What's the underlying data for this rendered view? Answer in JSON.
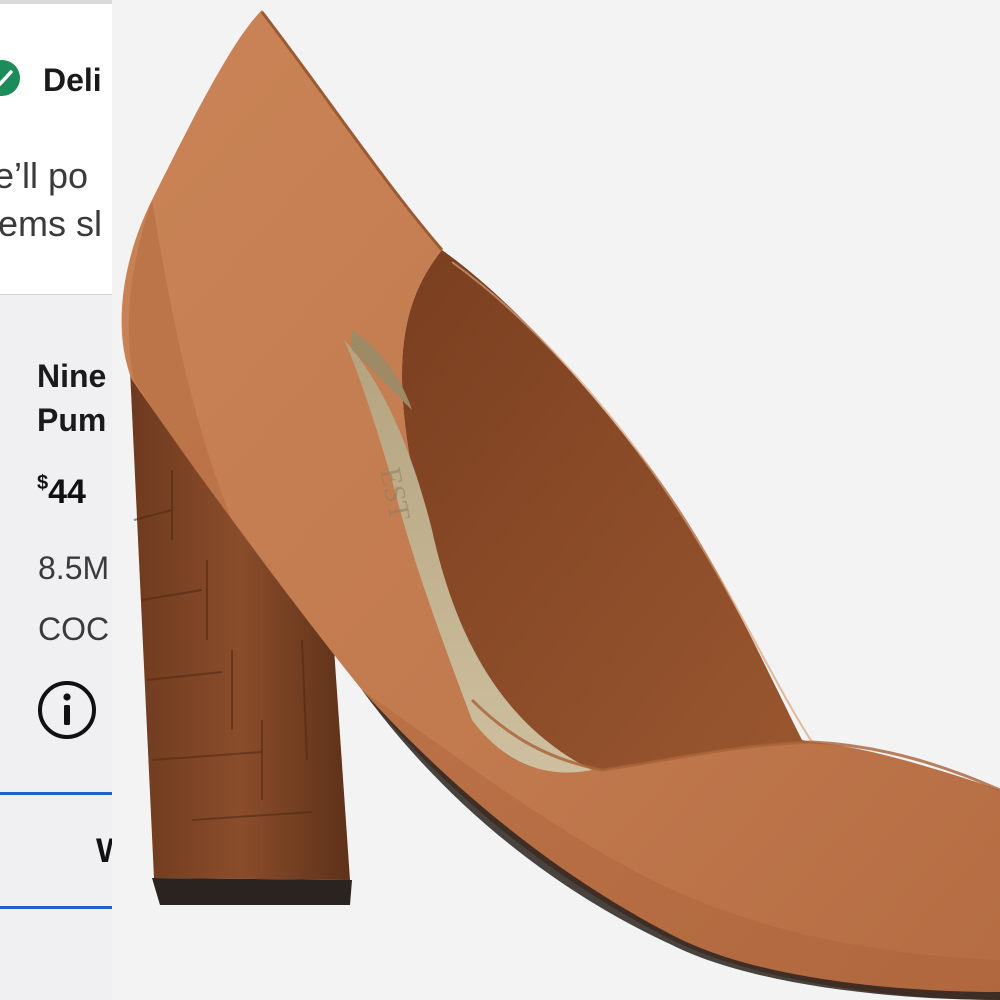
{
  "order_panel": {
    "delivery": {
      "title": "Deli",
      "line1": "e’ll po",
      "line2": "ems sl"
    },
    "item": {
      "name_line1": "Nine",
      "name_line2": "Pum",
      "price_currency": "$",
      "price_amount": "44",
      "size": "8.5M",
      "color": "COC",
      "action_label": "W"
    }
  },
  "product_image": {
    "logo_text": "EST",
    "colors": {
      "suede": "#c27a4f",
      "suede_shadow": "#a85f37",
      "lining": "#8a4a26",
      "insole": "#c6b695",
      "heel": "#7d4425",
      "sole": "#2a2320",
      "background": "#f3f3f4"
    }
  },
  "colors": {
    "accent_blue": "#1f5fd1",
    "check_green": "#1e8b5a"
  }
}
